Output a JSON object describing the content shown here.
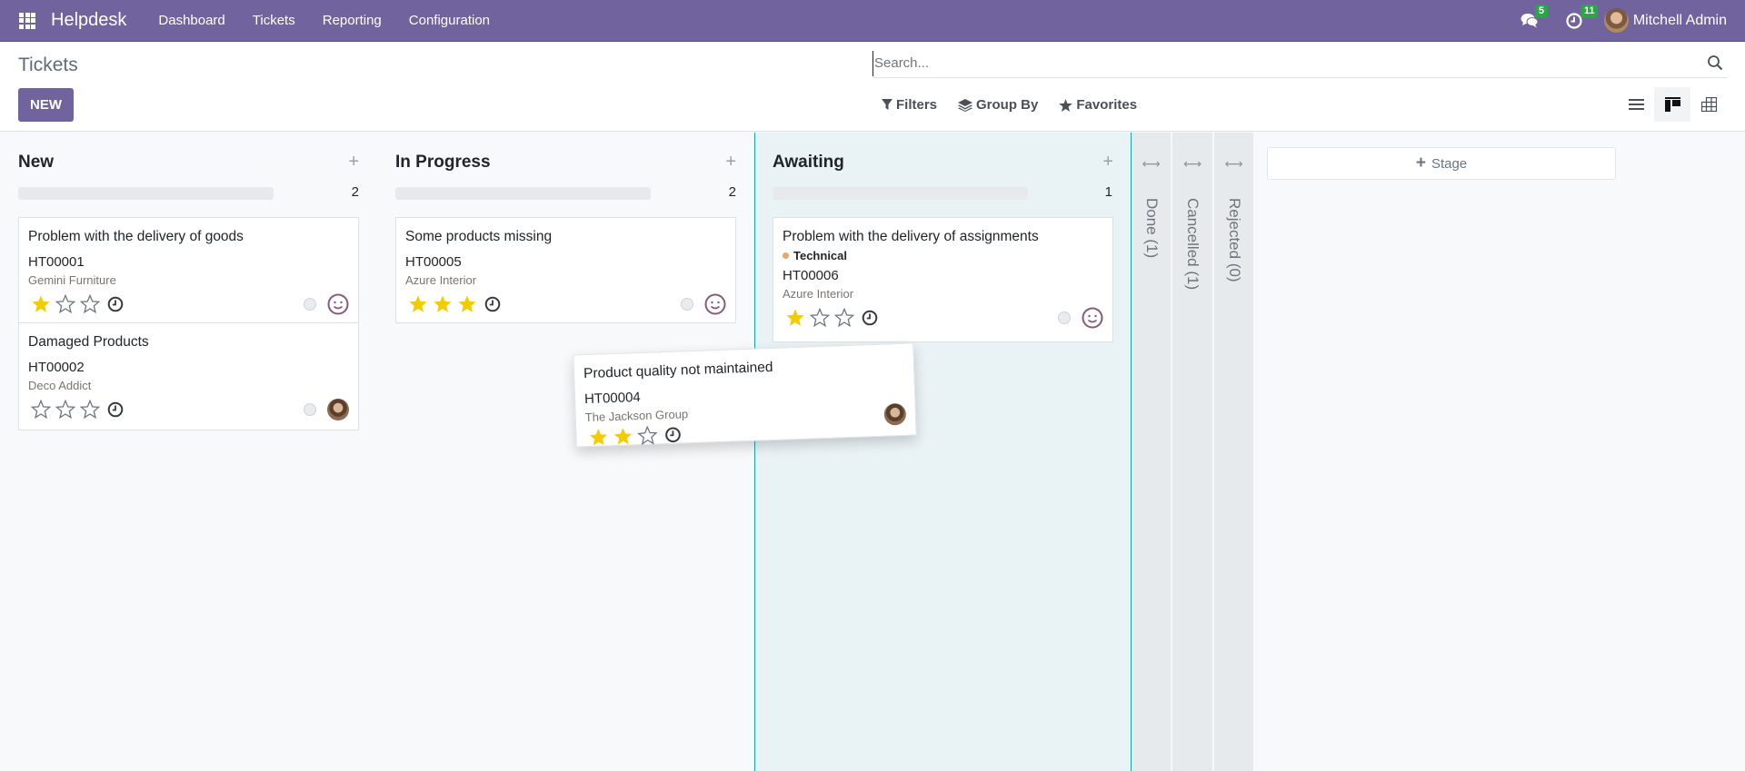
{
  "navbar": {
    "app_name": "Helpdesk",
    "menu": [
      "Dashboard",
      "Tickets",
      "Reporting",
      "Configuration"
    ],
    "messages_count": "5",
    "activities_count": "11",
    "user_name": "Mitchell Admin",
    "accent_color": "#71639e"
  },
  "control_panel": {
    "title": "Tickets",
    "new_label": "NEW",
    "search_placeholder": "Search...",
    "search_value": "",
    "filters_label": "Filters",
    "group_by_label": "Group By",
    "favorites_label": "Favorites",
    "views": [
      "list",
      "kanban",
      "pivot"
    ],
    "active_view": "kanban"
  },
  "columns": [
    {
      "title": "New",
      "count": "2",
      "cards": [
        {
          "title": "Problem with the delivery of goods",
          "ref": "HT00001",
          "partner": "Gemini Furniture",
          "priority": 1,
          "assignee": "smiley"
        },
        {
          "title": "Damaged Products",
          "ref": "HT00002",
          "partner": "Deco Addict",
          "priority": 0,
          "assignee": "avatar"
        }
      ]
    },
    {
      "title": "In Progress",
      "count": "2",
      "cards": [
        {
          "title": "Some products missing",
          "ref": "HT00005",
          "partner": "Azure Interior",
          "priority": 3,
          "assignee": "smiley"
        }
      ]
    },
    {
      "title": "Awaiting",
      "count": "1",
      "cards": [
        {
          "title": "Problem with the delivery of assignments",
          "tag": "Technical",
          "tag_color": "#f4a261",
          "ref": "HT00006",
          "partner": "Azure Interior",
          "priority": 1,
          "assignee": "smiley"
        }
      ]
    }
  ],
  "folded_columns": [
    {
      "label": "Done (1)"
    },
    {
      "label": "Cancelled (1)"
    },
    {
      "label": "Rejected (0)"
    }
  ],
  "add_stage_label": "Stage",
  "dragged_card": {
    "title": "Product quality not maintained",
    "ref": "HT00004",
    "partner": "The Jackson Group",
    "priority": 2,
    "assignee": "avatar"
  }
}
